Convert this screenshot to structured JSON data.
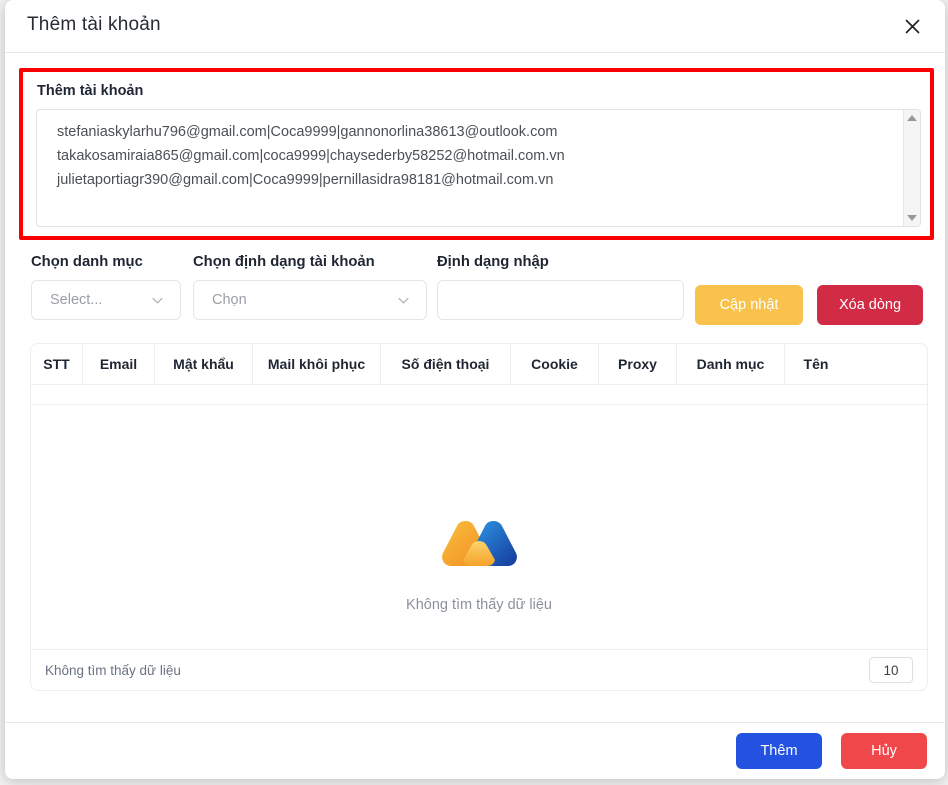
{
  "backdrop": {
    "obscured_text": "Không tìm thấy dữ liệu"
  },
  "dialog": {
    "title": "Thêm tài khoản",
    "close_icon": "close-icon",
    "section_label": "Thêm tài khoản",
    "accounts_textarea": {
      "value": "stefaniaskylarhu796@gmail.com|Coca9999|gannonorlina38613@outlook.com\ntakakosamiraia865@gmail.com|coca9999|chaysederby58252@hotmail.com.vn\njulietaportiagr390@gmail.com|Coca9999|pernillasidra98181@hotmail.com.vn",
      "placeholder": "",
      "lines": [
        "stefaniaskylarhu796@gmail.com|Coca9999|gannonorlina38613@outlook.com",
        "takakosamiraia865@gmail.com|coca9999|chaysederby58252@hotmail.com.vn",
        "julietaportiagr390@gmail.com|Coca9999|pernillasidra98181@hotmail.com.vn"
      ]
    },
    "controls": {
      "category": {
        "label": "Chọn danh mục",
        "value": "Select...",
        "icon": "chevron-down-icon"
      },
      "account_format": {
        "label": "Chọn định dạng tài khoản",
        "value": "Chọn",
        "icon": "chevron-down-icon"
      },
      "input_format": {
        "label": "Định dạng nhập",
        "value": "",
        "placeholder": ""
      },
      "update_button": "Cập nhật",
      "delete_row_button": "Xóa dòng"
    },
    "table": {
      "columns": [
        "STT",
        "Email",
        "Mật khẩu",
        "Mail khôi phục",
        "Số điện thoại",
        "Cookie",
        "Proxy",
        "Danh mục",
        "Tên"
      ],
      "rows": [],
      "empty_text": "Không tìm thấy dữ liệu",
      "empty_logo": "no-data-logo",
      "footer_text": "Không tìm thấy dữ liệu",
      "page_size": "10"
    },
    "footer": {
      "add_button": "Thêm",
      "cancel_button": "Hủy"
    }
  },
  "colors": {
    "annotation": "#fb0000",
    "update": "#f8c24c",
    "delete": "#d22b45",
    "add": "#2351e0",
    "cancel": "#f0474a"
  }
}
